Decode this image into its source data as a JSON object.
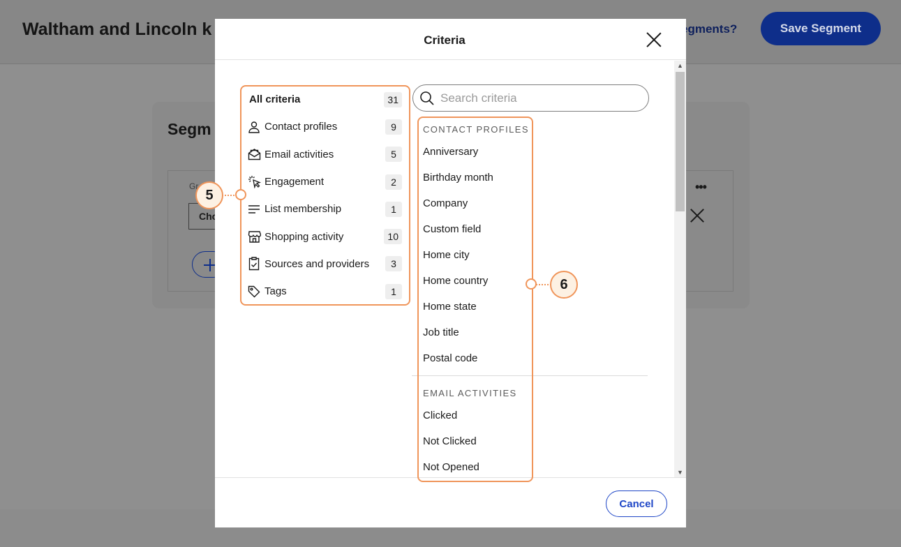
{
  "background": {
    "title": "Waltham and Lincoln k",
    "help_link": "egments?",
    "save_button": "Save Segment",
    "card_title": "Segm",
    "group_label": "Gr",
    "choose_text": "Cho",
    "more_icon": "ellipsis-icon"
  },
  "modal": {
    "title": "Criteria",
    "cancel_label": "Cancel",
    "search_placeholder": "Search criteria",
    "search_value": "",
    "categories": [
      {
        "label": "All criteria",
        "count": "31",
        "icon": "none",
        "active": true
      },
      {
        "label": "Contact profiles",
        "count": "9",
        "icon": "person-icon"
      },
      {
        "label": "Email activities",
        "count": "5",
        "icon": "envelope-icon"
      },
      {
        "label": "Engagement",
        "count": "2",
        "icon": "cursor-click-icon"
      },
      {
        "label": "List membership",
        "count": "1",
        "icon": "list-icon"
      },
      {
        "label": "Shopping activity",
        "count": "10",
        "icon": "store-icon"
      },
      {
        "label": "Sources and providers",
        "count": "3",
        "icon": "clipboard-check-icon"
      },
      {
        "label": "Tags",
        "count": "1",
        "icon": "tag-icon"
      }
    ],
    "sections": [
      {
        "heading": "CONTACT PROFILES",
        "items": [
          "Anniversary",
          "Birthday month",
          "Company",
          "Custom field",
          "Home city",
          "Home country",
          "Home state",
          "Job title",
          "Postal code"
        ]
      },
      {
        "heading": "EMAIL ACTIVITIES",
        "items": [
          "Clicked",
          "Not Clicked",
          "Not Opened"
        ]
      }
    ]
  },
  "callouts": {
    "left": "5",
    "right": "6"
  },
  "colors": {
    "accent": "#f0955a",
    "primary": "#1f47c7",
    "save": "#0e2e8a"
  }
}
